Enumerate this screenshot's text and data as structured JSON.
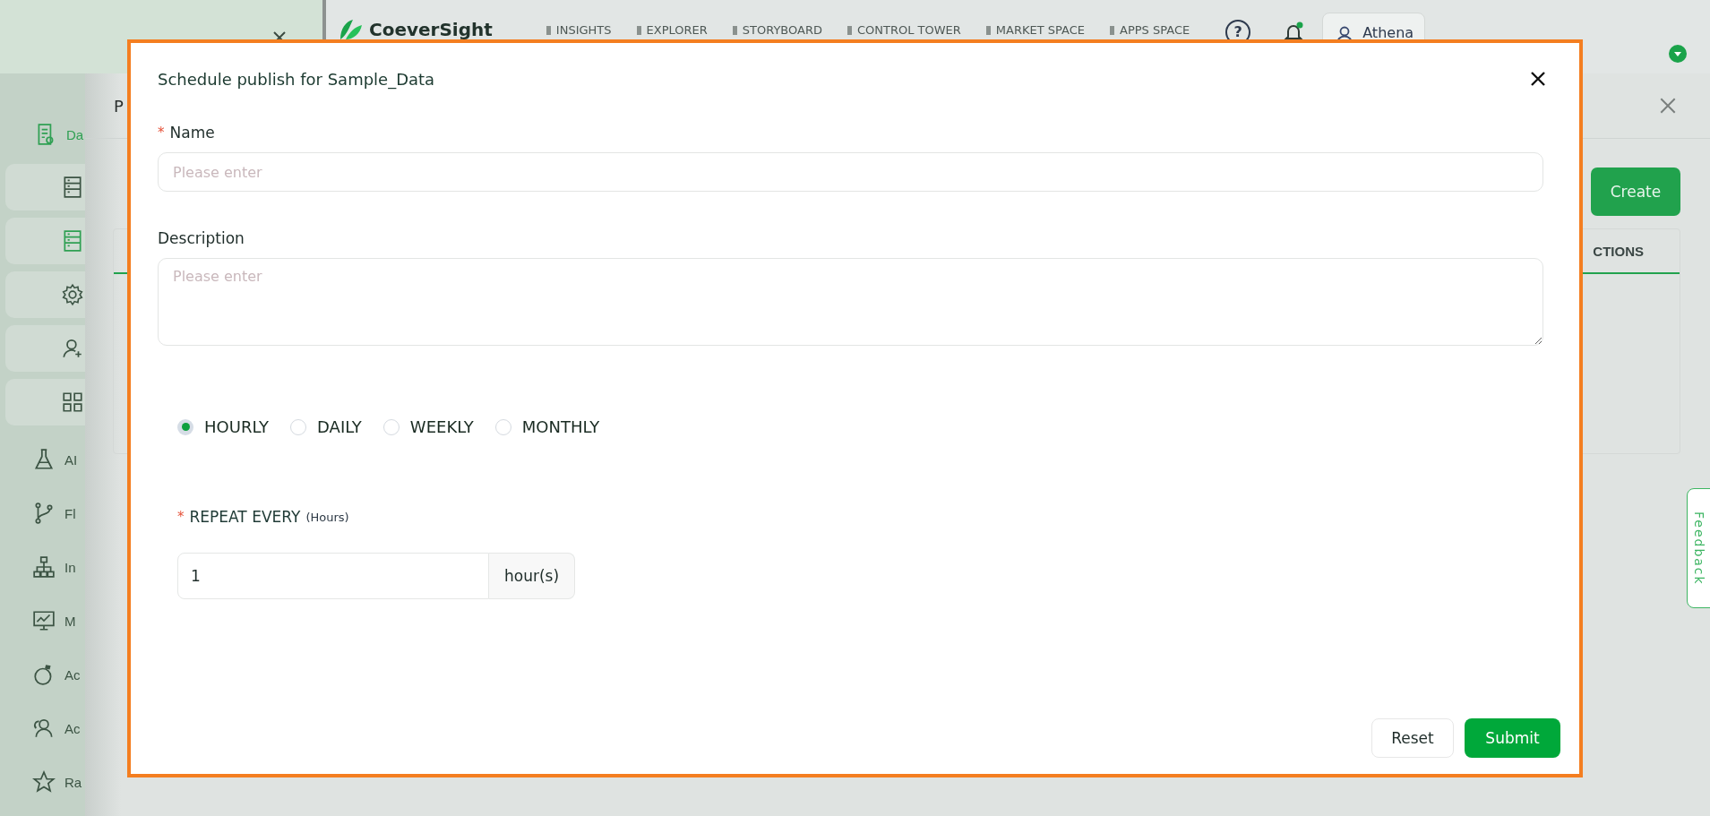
{
  "topbar": {
    "logo": "CoeverSight",
    "nav": [
      {
        "label": "INSIGHTS"
      },
      {
        "label": "EXPLORER"
      },
      {
        "label": "STORYBOARD"
      },
      {
        "label": "CONTROL TOWER"
      },
      {
        "label": "MARKET SPACE"
      },
      {
        "label": "APPS SPACE"
      }
    ],
    "help": "?",
    "notification": true,
    "user": "Athena"
  },
  "sidebar": {
    "section": {
      "label": "Da",
      "selected": true
    },
    "sub_items": [
      {
        "selected": false
      },
      {
        "selected": true
      },
      {
        "selected": false
      },
      {
        "selected": false
      },
      {
        "selected": false
      }
    ],
    "items": [
      {
        "label": "AI"
      },
      {
        "label": "Fl"
      },
      {
        "label": "In"
      },
      {
        "label": "M"
      },
      {
        "label": "Ac"
      },
      {
        "label": "Ac"
      },
      {
        "label": "Ra"
      }
    ]
  },
  "drawer": {
    "title": "P",
    "create": "Create",
    "column": "CTIONS"
  },
  "modal": {
    "title": "Schedule publish for Sample_Data",
    "name": {
      "label": "Name",
      "required_mark": "*",
      "placeholder": "Please enter"
    },
    "description": {
      "label": "Description",
      "placeholder": "Please enter"
    },
    "frequency": [
      {
        "label": "HOURLY",
        "selected": true
      },
      {
        "label": "DAILY",
        "selected": false
      },
      {
        "label": "WEEKLY",
        "selected": false
      },
      {
        "label": "MONTHLY",
        "selected": false
      }
    ],
    "repeat": {
      "label": "REPEAT EVERY",
      "unit": "(Hours)",
      "required_mark": "*",
      "value": "1",
      "addon": "hour(s)"
    },
    "buttons": {
      "reset": "Reset",
      "submit": "Submit"
    }
  },
  "feedback": "Feedback"
}
